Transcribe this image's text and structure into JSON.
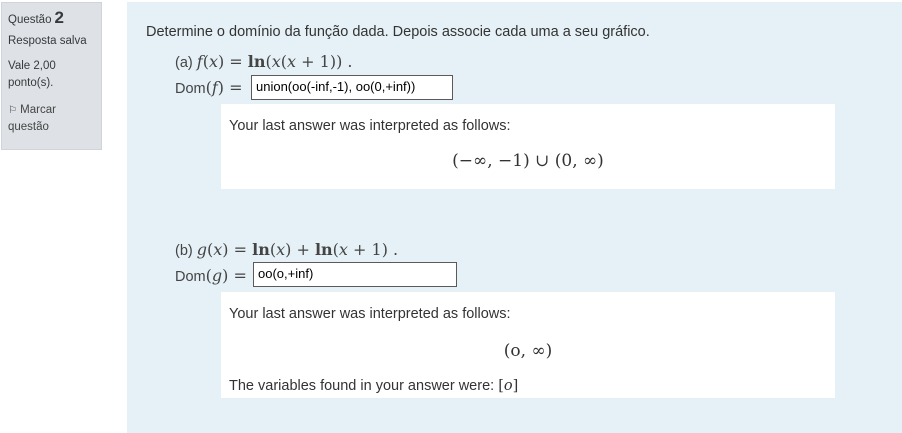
{
  "info": {
    "question_label": "Questão",
    "question_number": "2",
    "status": "Resposta salva",
    "grade_line1": "Vale 2,00",
    "grade_line2": "ponto(s).",
    "flag_line1": "Marcar",
    "flag_line2": "questão",
    "flag_icon": "flag-icon"
  },
  "question": {
    "prompt": "Determine o domínio da função dada. Depois associe cada uma a seu gráfico.",
    "part_a": {
      "tag": "(a)",
      "dom_label": "Dom",
      "answer": "union(oo(-inf,-1), oo(0,+inf))",
      "feedback": "Your last answer was interpreted as follows:",
      "interpretation": "(−∞, −1) ∪ (0, ∞)"
    },
    "part_b": {
      "tag": "(b)",
      "dom_label": "Dom",
      "answer": "oo(o,+inf)",
      "feedback": "Your last answer was interpreted as follows:",
      "interpretation": "(o, ∞)",
      "variables_text": "The variables found in your answer were:",
      "variables_value": "o"
    }
  }
}
